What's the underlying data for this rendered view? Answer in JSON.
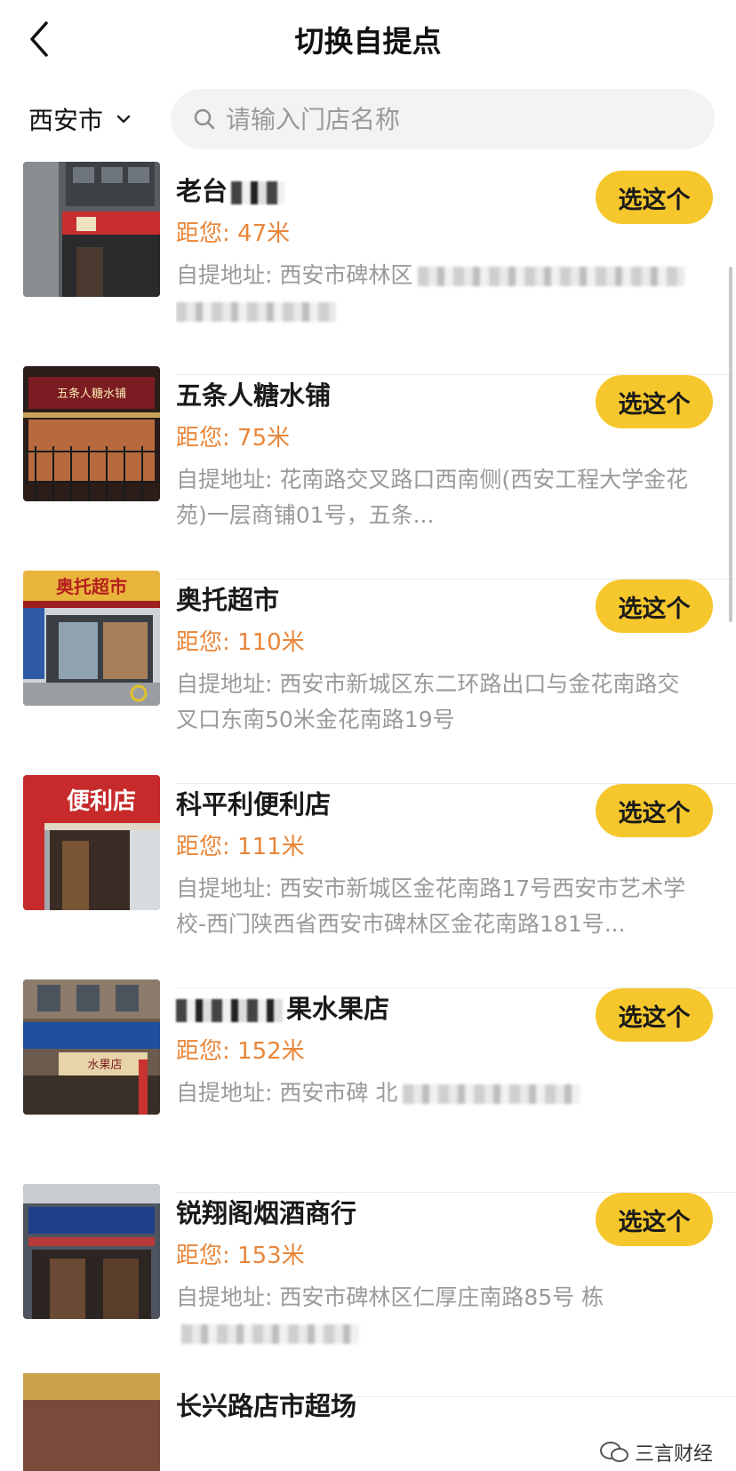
{
  "header": {
    "title": "切换自提点"
  },
  "filter": {
    "city": "西安市",
    "search_placeholder": "请输入门店名称"
  },
  "stores": [
    {
      "name": "老台",
      "distance": "距您: 47米",
      "address": "自提地址: 西安市碑林区",
      "button": "选这个"
    },
    {
      "name": "五条人糖水铺",
      "distance": "距您: 75米",
      "address": "自提地址: 花南路交叉路口西南侧(西安工程大学金花苑)一层商铺01号，五条...",
      "button": "选这个"
    },
    {
      "name": "奥托超市",
      "distance": "距您: 110米",
      "address": "自提地址: 西安市新城区东二环路出口与金花南路交叉口东南50米金花南路19号",
      "button": "选这个"
    },
    {
      "name": "科平利便利店",
      "distance": "距您: 111米",
      "address": "自提地址: 西安市新城区金花南路17号西安市艺术学校-西门陕西省西安市碑林区金花南路181号...",
      "button": "选这个"
    },
    {
      "name": "果水果店",
      "distance": "距您: 152米",
      "address": "自提地址: 西安市碑 北",
      "button": "选这个"
    },
    {
      "name": "锐翔阁烟酒商行",
      "distance": "距您: 153米",
      "address": "自提地址: 西安市碑林区仁厚庄南路85号 栋",
      "button": "选这个"
    }
  ],
  "partial_store": {
    "name": "长兴路店市超场"
  },
  "thumb_signs": [
    "五条人糖水铺",
    "奥托超市",
    "便利店",
    "水果店"
  ],
  "watermark": {
    "text": "三言财经"
  },
  "colors": {
    "accent": "#f5c72d",
    "distance": "#e8863a",
    "muted": "#9a9a9a"
  }
}
